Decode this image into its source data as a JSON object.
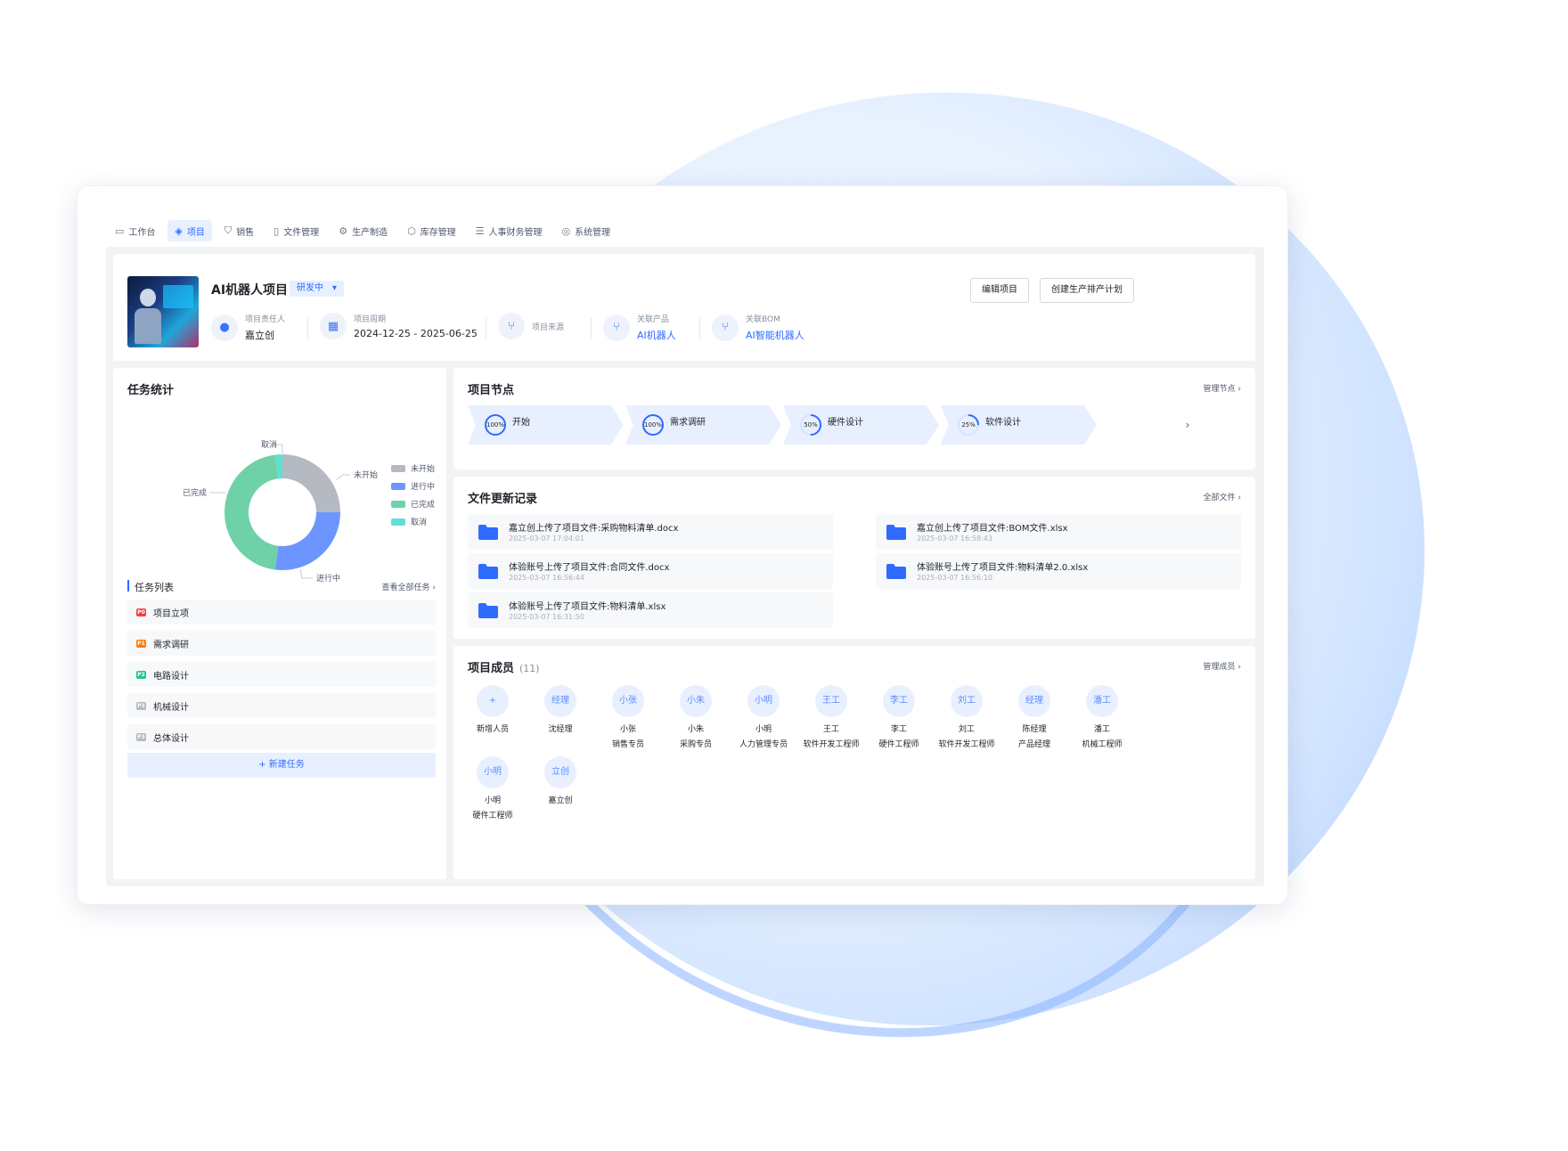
{
  "nav": [
    {
      "icon": "monitor-icon",
      "label": "工作台"
    },
    {
      "icon": "layers-icon",
      "label": "项目",
      "active": true
    },
    {
      "icon": "cart-icon",
      "label": "销售"
    },
    {
      "icon": "file-icon",
      "label": "文件管理"
    },
    {
      "icon": "gear-icon",
      "label": "生产制造"
    },
    {
      "icon": "box-icon",
      "label": "库存管理"
    },
    {
      "icon": "stack-icon",
      "label": "人事财务管理"
    },
    {
      "icon": "settings-icon",
      "label": "系统管理"
    }
  ],
  "project": {
    "title": "AI机器人项目",
    "status": "研发中",
    "owner_label": "项目责任人",
    "owner": "嘉立创",
    "period_label": "项目周期",
    "period": "2024-12-25 - 2025-06-25",
    "source_label": "项目来源",
    "product_label": "关联产品",
    "product": "AI机器人",
    "bom_label": "关联BOM",
    "bom": "AI智能机器人",
    "edit_button": "编辑项目",
    "plan_button": "创建生产排产计划"
  },
  "stats": {
    "title": "任务统计",
    "legend": [
      {
        "label": "未开始",
        "color": "#b4b9c2"
      },
      {
        "label": "进行中",
        "color": "#6c95ff"
      },
      {
        "label": "已完成",
        "color": "#6fd1a8"
      },
      {
        "label": "取消",
        "color": "#5ee0d4"
      }
    ],
    "callouts": {
      "cancel": "取消",
      "not_started": "未开始",
      "done": "已完成",
      "in_progress": "进行中"
    },
    "list_title": "任务列表",
    "view_all": "查看全部任务",
    "tasks": [
      {
        "prio": "P0",
        "color": "#f53f3f",
        "name": "项目立项"
      },
      {
        "prio": "P1",
        "color": "#ff7d00",
        "name": "需求调研"
      },
      {
        "prio": "P2",
        "color": "#23c38e",
        "name": "电路设计"
      },
      {
        "prio": "P3",
        "color": "#b4b9c2",
        "name": "机械设计"
      },
      {
        "prio": "P3",
        "color": "#b4b9c2",
        "name": "总体设计"
      }
    ],
    "new_task": "+ 新建任务"
  },
  "chart_data": {
    "type": "pie",
    "categories": [
      "未开始",
      "进行中",
      "已完成",
      "取消"
    ],
    "values": [
      25,
      27,
      46,
      2
    ]
  },
  "nodes": {
    "title": "项目节点",
    "manage": "管理节点",
    "items": [
      {
        "name": "开始",
        "progress": 100,
        "label": "100%"
      },
      {
        "name": "需求调研",
        "progress": 100,
        "label": "100%"
      },
      {
        "name": "硬件设计",
        "progress": 50,
        "label": "50%"
      },
      {
        "name": "软件设计",
        "progress": 25,
        "label": "25%"
      }
    ]
  },
  "files": {
    "title": "文件更新记录",
    "all": "全部文件",
    "items": [
      {
        "name": "嘉立创上传了项目文件:采购物料清单.docx",
        "time": "2025-03-07 17:04:01"
      },
      {
        "name": "嘉立创上传了项目文件:BOM文件.xlsx",
        "time": "2025-03-07 16:58:43"
      },
      {
        "name": "体验账号上传了项目文件:合同文件.docx",
        "time": "2025-03-07 16:56:44"
      },
      {
        "name": "体验账号上传了项目文件:物料清单2.0.xlsx",
        "time": "2025-03-07 16:56:10"
      },
      {
        "name": "体验账号上传了项目文件:物料清单.xlsx",
        "time": "2025-03-07 16:31:50"
      }
    ]
  },
  "members": {
    "title": "项目成员",
    "count": "(11)",
    "manage": "管理成员",
    "items": [
      {
        "avatar": "+",
        "name": "新增人员",
        "role": ""
      },
      {
        "avatar": "经理",
        "name": "沈经理",
        "role": ""
      },
      {
        "avatar": "小张",
        "name": "小张",
        "role": "销售专员"
      },
      {
        "avatar": "小朱",
        "name": "小朱",
        "role": "采购专员"
      },
      {
        "avatar": "小明",
        "name": "小明",
        "role": "人力管理专员"
      },
      {
        "avatar": "王工",
        "name": "王工",
        "role": "软件开发工程师"
      },
      {
        "avatar": "李工",
        "name": "李工",
        "role": "硬件工程师"
      },
      {
        "avatar": "刘工",
        "name": "刘工",
        "role": "软件开发工程师"
      },
      {
        "avatar": "经理",
        "name": "陈经理",
        "role": "产品经理"
      },
      {
        "avatar": "潘工",
        "name": "潘工",
        "role": "机械工程师"
      },
      {
        "avatar": "小明",
        "name": "小明",
        "role": "硬件工程师"
      },
      {
        "avatar": "立创",
        "name": "嘉立创",
        "role": ""
      }
    ]
  }
}
